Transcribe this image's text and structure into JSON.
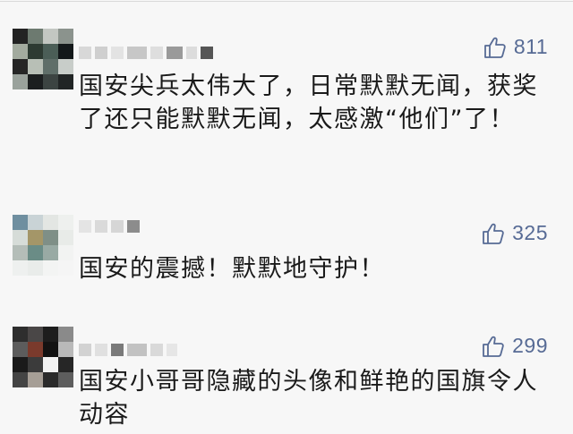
{
  "comments": [
    {
      "likes": "811",
      "text": "国安尖兵太伟大了，日常默默无闻，获奖了还只能默默无闻，太感激“他们”了！"
    },
    {
      "likes": "325",
      "text": "国安的震撼！默默地守护！"
    },
    {
      "likes": "299",
      "text": "国安小哥哥隐藏的头像和鲜艳的国旗令人动容"
    }
  ],
  "colors": {
    "accent": "#576b95",
    "text": "#1a1a1a",
    "background": "#f7f7f7"
  },
  "icons": {
    "like": "thumbs-up-icon"
  }
}
